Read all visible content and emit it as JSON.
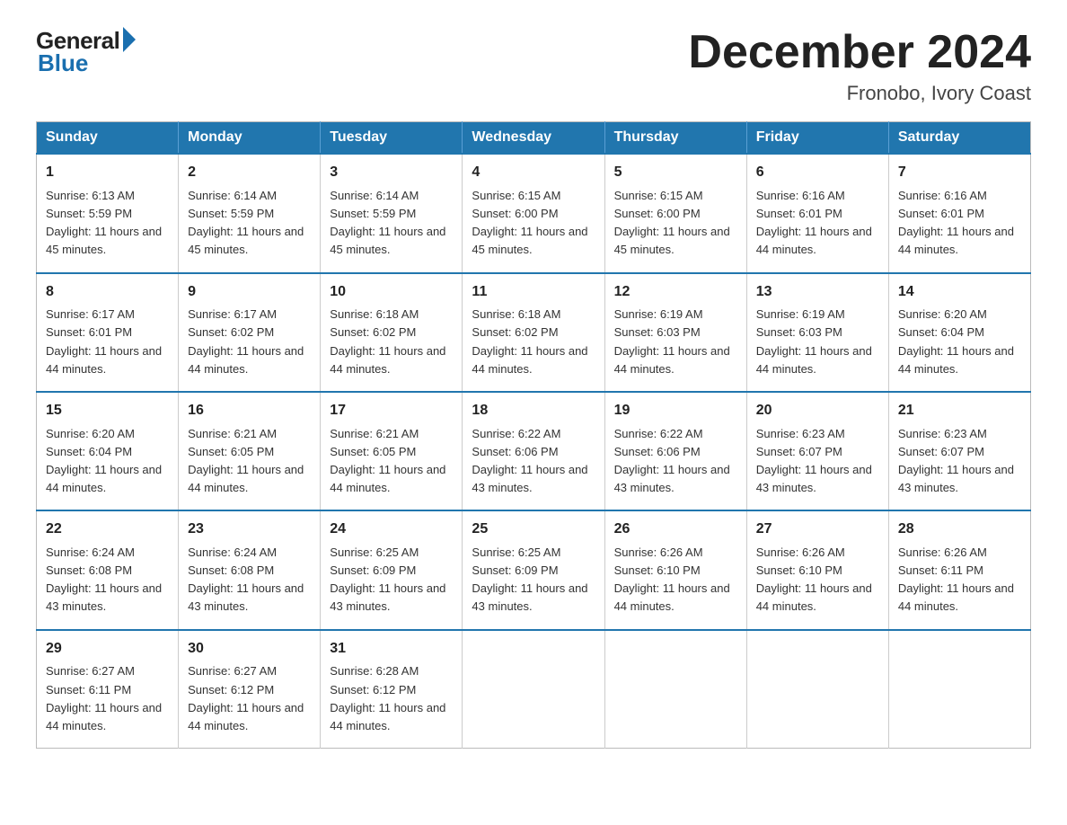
{
  "logo": {
    "general": "General",
    "blue": "Blue"
  },
  "title": "December 2024",
  "subtitle": "Fronobo, Ivory Coast",
  "headers": [
    "Sunday",
    "Monday",
    "Tuesday",
    "Wednesday",
    "Thursday",
    "Friday",
    "Saturday"
  ],
  "weeks": [
    [
      {
        "day": "1",
        "sunrise": "6:13 AM",
        "sunset": "5:59 PM",
        "daylight": "11 hours and 45 minutes."
      },
      {
        "day": "2",
        "sunrise": "6:14 AM",
        "sunset": "5:59 PM",
        "daylight": "11 hours and 45 minutes."
      },
      {
        "day": "3",
        "sunrise": "6:14 AM",
        "sunset": "5:59 PM",
        "daylight": "11 hours and 45 minutes."
      },
      {
        "day": "4",
        "sunrise": "6:15 AM",
        "sunset": "6:00 PM",
        "daylight": "11 hours and 45 minutes."
      },
      {
        "day": "5",
        "sunrise": "6:15 AM",
        "sunset": "6:00 PM",
        "daylight": "11 hours and 45 minutes."
      },
      {
        "day": "6",
        "sunrise": "6:16 AM",
        "sunset": "6:01 PM",
        "daylight": "11 hours and 44 minutes."
      },
      {
        "day": "7",
        "sunrise": "6:16 AM",
        "sunset": "6:01 PM",
        "daylight": "11 hours and 44 minutes."
      }
    ],
    [
      {
        "day": "8",
        "sunrise": "6:17 AM",
        "sunset": "6:01 PM",
        "daylight": "11 hours and 44 minutes."
      },
      {
        "day": "9",
        "sunrise": "6:17 AM",
        "sunset": "6:02 PM",
        "daylight": "11 hours and 44 minutes."
      },
      {
        "day": "10",
        "sunrise": "6:18 AM",
        "sunset": "6:02 PM",
        "daylight": "11 hours and 44 minutes."
      },
      {
        "day": "11",
        "sunrise": "6:18 AM",
        "sunset": "6:02 PM",
        "daylight": "11 hours and 44 minutes."
      },
      {
        "day": "12",
        "sunrise": "6:19 AM",
        "sunset": "6:03 PM",
        "daylight": "11 hours and 44 minutes."
      },
      {
        "day": "13",
        "sunrise": "6:19 AM",
        "sunset": "6:03 PM",
        "daylight": "11 hours and 44 minutes."
      },
      {
        "day": "14",
        "sunrise": "6:20 AM",
        "sunset": "6:04 PM",
        "daylight": "11 hours and 44 minutes."
      }
    ],
    [
      {
        "day": "15",
        "sunrise": "6:20 AM",
        "sunset": "6:04 PM",
        "daylight": "11 hours and 44 minutes."
      },
      {
        "day": "16",
        "sunrise": "6:21 AM",
        "sunset": "6:05 PM",
        "daylight": "11 hours and 44 minutes."
      },
      {
        "day": "17",
        "sunrise": "6:21 AM",
        "sunset": "6:05 PM",
        "daylight": "11 hours and 44 minutes."
      },
      {
        "day": "18",
        "sunrise": "6:22 AM",
        "sunset": "6:06 PM",
        "daylight": "11 hours and 43 minutes."
      },
      {
        "day": "19",
        "sunrise": "6:22 AM",
        "sunset": "6:06 PM",
        "daylight": "11 hours and 43 minutes."
      },
      {
        "day": "20",
        "sunrise": "6:23 AM",
        "sunset": "6:07 PM",
        "daylight": "11 hours and 43 minutes."
      },
      {
        "day": "21",
        "sunrise": "6:23 AM",
        "sunset": "6:07 PM",
        "daylight": "11 hours and 43 minutes."
      }
    ],
    [
      {
        "day": "22",
        "sunrise": "6:24 AM",
        "sunset": "6:08 PM",
        "daylight": "11 hours and 43 minutes."
      },
      {
        "day": "23",
        "sunrise": "6:24 AM",
        "sunset": "6:08 PM",
        "daylight": "11 hours and 43 minutes."
      },
      {
        "day": "24",
        "sunrise": "6:25 AM",
        "sunset": "6:09 PM",
        "daylight": "11 hours and 43 minutes."
      },
      {
        "day": "25",
        "sunrise": "6:25 AM",
        "sunset": "6:09 PM",
        "daylight": "11 hours and 43 minutes."
      },
      {
        "day": "26",
        "sunrise": "6:26 AM",
        "sunset": "6:10 PM",
        "daylight": "11 hours and 44 minutes."
      },
      {
        "day": "27",
        "sunrise": "6:26 AM",
        "sunset": "6:10 PM",
        "daylight": "11 hours and 44 minutes."
      },
      {
        "day": "28",
        "sunrise": "6:26 AM",
        "sunset": "6:11 PM",
        "daylight": "11 hours and 44 minutes."
      }
    ],
    [
      {
        "day": "29",
        "sunrise": "6:27 AM",
        "sunset": "6:11 PM",
        "daylight": "11 hours and 44 minutes."
      },
      {
        "day": "30",
        "sunrise": "6:27 AM",
        "sunset": "6:12 PM",
        "daylight": "11 hours and 44 minutes."
      },
      {
        "day": "31",
        "sunrise": "6:28 AM",
        "sunset": "6:12 PM",
        "daylight": "11 hours and 44 minutes."
      },
      null,
      null,
      null,
      null
    ]
  ]
}
